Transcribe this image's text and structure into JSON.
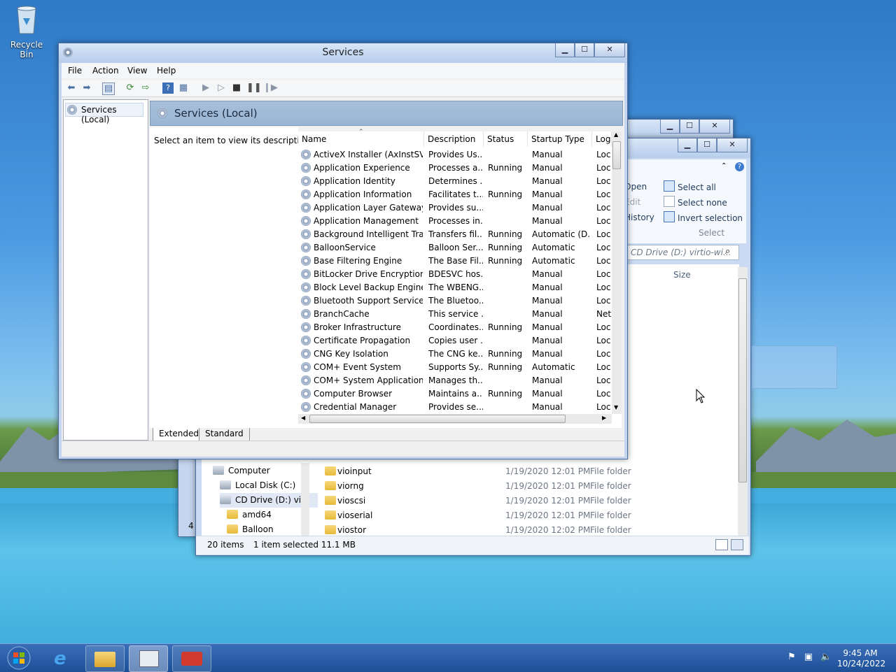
{
  "desktop": {
    "icons": [
      {
        "label": "Recycle Bin",
        "icon": "recycle-bin-icon"
      }
    ]
  },
  "services_window": {
    "title": "Services",
    "menu": [
      "File",
      "Action",
      "View",
      "Help"
    ],
    "tree_root": "Services (Local)",
    "header": "Services (Local)",
    "description_hint": "Select an item to view its description.",
    "columns": [
      "Name",
      "Description",
      "Status",
      "Startup Type",
      "Log"
    ],
    "rows": [
      {
        "name": "ActiveX Installer (AxInstSV)",
        "description": "Provides Us...",
        "status": "",
        "startup": "Manual",
        "log": "Loc"
      },
      {
        "name": "Application Experience",
        "description": "Processes a...",
        "status": "Running",
        "startup": "Manual",
        "log": "Loc"
      },
      {
        "name": "Application Identity",
        "description": "Determines ...",
        "status": "",
        "startup": "Manual",
        "log": "Loc"
      },
      {
        "name": "Application Information",
        "description": "Facilitates t...",
        "status": "Running",
        "startup": "Manual",
        "log": "Loc"
      },
      {
        "name": "Application Layer Gateway ...",
        "description": "Provides su...",
        "status": "",
        "startup": "Manual",
        "log": "Loc"
      },
      {
        "name": "Application Management",
        "description": "Processes in...",
        "status": "",
        "startup": "Manual",
        "log": "Loc"
      },
      {
        "name": "Background Intelligent Tran...",
        "description": "Transfers fil...",
        "status": "Running",
        "startup": "Automatic (D...",
        "log": "Loc"
      },
      {
        "name": "BalloonService",
        "description": "Balloon Ser...",
        "status": "Running",
        "startup": "Automatic",
        "log": "Loc"
      },
      {
        "name": "Base Filtering Engine",
        "description": "The Base Fil...",
        "status": "Running",
        "startup": "Automatic",
        "log": "Loc"
      },
      {
        "name": "BitLocker Drive Encryption ...",
        "description": "BDESVC hos...",
        "status": "",
        "startup": "Manual",
        "log": "Loc"
      },
      {
        "name": "Block Level Backup Engine ...",
        "description": "The WBENG...",
        "status": "",
        "startup": "Manual",
        "log": "Loc"
      },
      {
        "name": "Bluetooth Support Service",
        "description": "The Bluetoo...",
        "status": "",
        "startup": "Manual",
        "log": "Loc"
      },
      {
        "name": "BranchCache",
        "description": "This service ...",
        "status": "",
        "startup": "Manual",
        "log": "Net"
      },
      {
        "name": "Broker Infrastructure",
        "description": "Coordinates...",
        "status": "Running",
        "startup": "Manual",
        "log": "Loc"
      },
      {
        "name": "Certificate Propagation",
        "description": "Copies user ...",
        "status": "",
        "startup": "Manual",
        "log": "Loc"
      },
      {
        "name": "CNG Key Isolation",
        "description": "The CNG ke...",
        "status": "Running",
        "startup": "Manual",
        "log": "Loc"
      },
      {
        "name": "COM+ Event System",
        "description": "Supports Sy...",
        "status": "Running",
        "startup": "Automatic",
        "log": "Loc"
      },
      {
        "name": "COM+ System Application",
        "description": "Manages th...",
        "status": "",
        "startup": "Manual",
        "log": "Loc"
      },
      {
        "name": "Computer Browser",
        "description": "Maintains a...",
        "status": "Running",
        "startup": "Manual",
        "log": "Loc"
      },
      {
        "name": "Credential Manager",
        "description": "Provides se...",
        "status": "",
        "startup": "Manual",
        "log": "Loc"
      }
    ],
    "tabs": [
      "Extended",
      "Standard"
    ]
  },
  "explorer_window": {
    "ribbon": {
      "open": "Open",
      "edit": "Edit",
      "history": "History",
      "select_all": "Select all",
      "select_none": "Select none",
      "invert_selection": "Invert selection",
      "group_label": "Select"
    },
    "search_placeholder": "CD Drive (D:) virtio-wi...",
    "size_column": "Size",
    "nav": [
      {
        "label": "Computer",
        "indent": 1
      },
      {
        "label": "Local Disk (C:)",
        "indent": 2
      },
      {
        "label": "CD Drive (D:) virt",
        "indent": 2
      },
      {
        "label": "amd64",
        "indent": 3
      },
      {
        "label": "Balloon",
        "indent": 3
      }
    ],
    "files": [
      {
        "name": "vioinput",
        "date": "1/19/2020 12:01 PM",
        "type": "File folder"
      },
      {
        "name": "viorng",
        "date": "1/19/2020 12:01 PM",
        "type": "File folder"
      },
      {
        "name": "vioscsi",
        "date": "1/19/2020 12:01 PM",
        "type": "File folder"
      },
      {
        "name": "vioserial",
        "date": "1/19/2020 12:01 PM",
        "type": "File folder"
      },
      {
        "name": "viostor",
        "date": "1/19/2020 12:02 PM",
        "type": "File folder"
      }
    ],
    "status_items": "20 items",
    "status_selected": "1 item selected  11.1 MB"
  },
  "back_window": {
    "partial_text": "4"
  },
  "taskbar": {
    "time": "9:45 AM",
    "date": "10/24/2022"
  }
}
